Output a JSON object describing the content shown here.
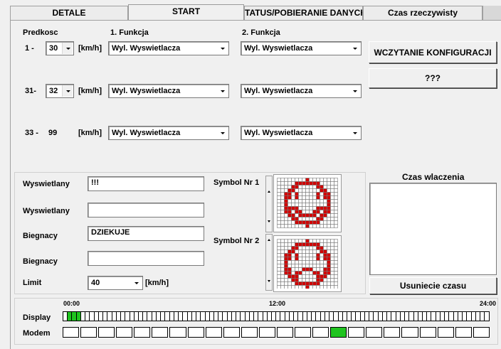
{
  "tabs": [
    {
      "label": "DETALE",
      "active": false
    },
    {
      "label": "START",
      "active": true
    },
    {
      "label": "STATUS/POBIERANIE DANYCH",
      "active": false
    },
    {
      "label": "Czas rzeczywisty",
      "active": false
    }
  ],
  "headers": {
    "speed": "Predkosc",
    "function1": "1. Funkcja",
    "function2": "2. Funkcja",
    "unit": "[km/h]"
  },
  "rows": [
    {
      "from": "1  -",
      "to": "30",
      "fn1": "Wyl. Wyswietlacza",
      "fn2": "Wyl. Wyswietlacza"
    },
    {
      "from": "31-",
      "to": "32",
      "fn1": "Wyl. Wyswietlacza",
      "fn2": "Wyl. Wyswietlacza"
    },
    {
      "from": "33 -",
      "to": "99",
      "fn1": "Wyl. Wyswietlacza",
      "fn2": "Wyl. Wyswietlacza"
    }
  ],
  "buttons": {
    "load_config": "WCZYTANIE KONFIGURACJI",
    "unknown": "???",
    "remove_time": "Usuniecie czasu"
  },
  "messages": {
    "field1_label": "Wyswietlany",
    "field1_value": "!!!",
    "field2_label": "Wyswietlany",
    "field2_value": "",
    "field3_label": "Biegnacy",
    "field3_value": "DZIEKUJE",
    "field4_label": "Biegnacy",
    "field4_value": "",
    "limit_label": "Limit",
    "limit_value": "40",
    "limit_unit": "[km/h]"
  },
  "symbols": {
    "symbol1_label": "Symbol Nr 1",
    "symbol2_label": "Symbol Nr 2",
    "symbol1_icon": "smiley-happy-icon",
    "symbol2_icon": "smiley-sad-icon",
    "pixel_color": "#d00000"
  },
  "time_panel": {
    "title": "Czas wlaczenia"
  },
  "timeline": {
    "tick_start": "00:00",
    "tick_mid": "12:00",
    "tick_end": "24:00",
    "display_label": "Display",
    "modem_label": "Modem",
    "display_on_indices": [
      1,
      2,
      3
    ],
    "modem_on_indices": [
      15
    ],
    "on_color": "#1fc41f"
  }
}
